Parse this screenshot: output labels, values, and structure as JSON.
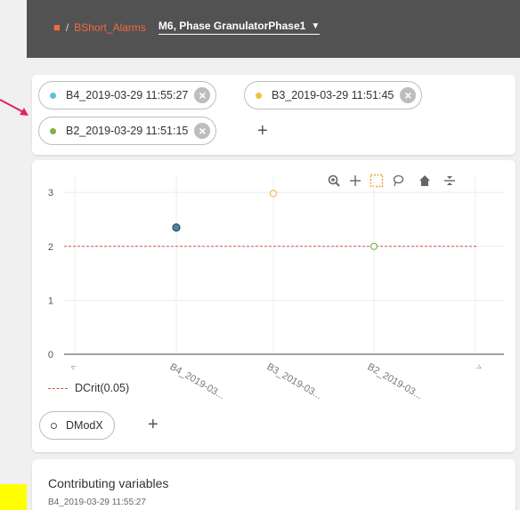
{
  "header": {
    "breadcrumb_link": "BShort_Alarms",
    "separator": "/",
    "phase": "M6, Phase GranulatorPhase1"
  },
  "filters": {
    "chips": [
      {
        "label": "B4_2019-03-29 11:55:27",
        "color": "#5bc0de"
      },
      {
        "label": "B3_2019-03-29 11:51:45",
        "color": "#f0c040"
      },
      {
        "label": "B2_2019-03-29 11:51:15",
        "color": "#7cb342"
      }
    ],
    "add": "+"
  },
  "chart_data": {
    "type": "scatter",
    "categories": [
      "B4_2019-03...",
      "B3_2019-03...",
      "B2_2019-03..."
    ],
    "series": [
      {
        "name": "DModX",
        "values": [
          {
            "category": "B4_2019-03...",
            "y": 2.35,
            "color": "#4a86a8"
          },
          {
            "category": "B3_2019-03...",
            "y": 2.98,
            "color": "#f0c040"
          },
          {
            "category": "B2_2019-03...",
            "y": 2.0,
            "color": "#7cb342"
          }
        ]
      }
    ],
    "reference_line": {
      "name": "DCrit(0.05)",
      "y": 2.0,
      "color": "#d9534f"
    },
    "ylim": [
      0,
      3.3
    ],
    "yticks": [
      "0",
      "1",
      "2",
      "3"
    ]
  },
  "legend": {
    "dcrit": "DCrit(0.05)",
    "series_chip": "DModX",
    "add": "+"
  },
  "contrib": {
    "title": "Contributing variables",
    "subtitle": "B4_2019-03-29 11:55:27"
  }
}
